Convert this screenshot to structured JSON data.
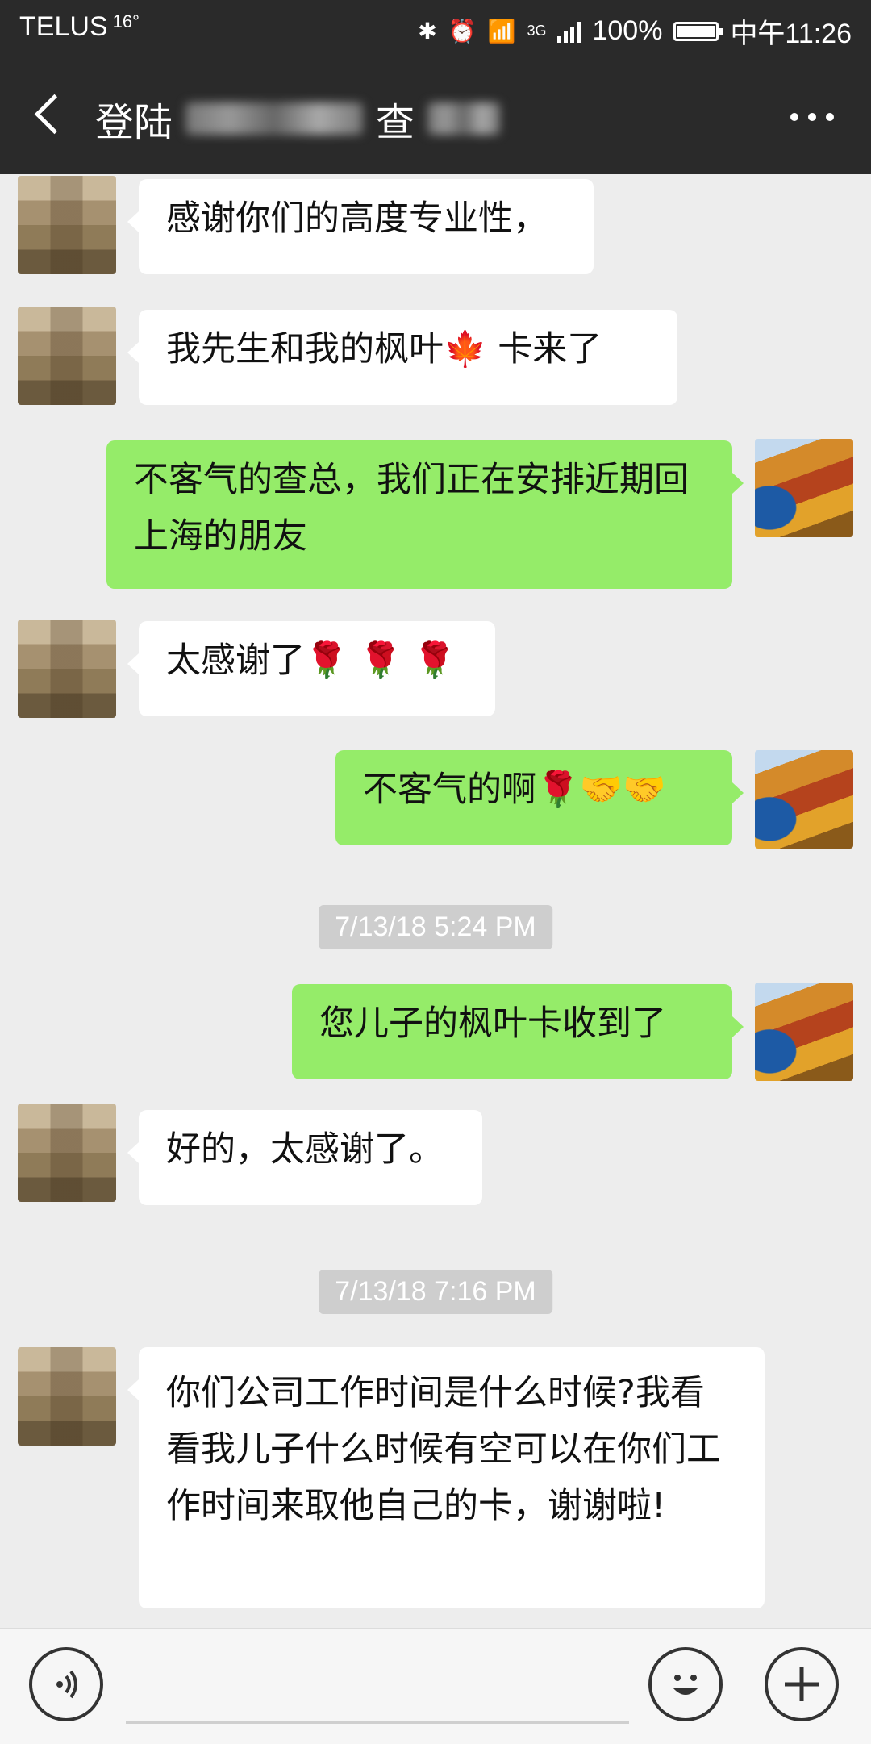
{
  "status_bar": {
    "carrier": "TELUS",
    "temperature": "16°",
    "network": "3G",
    "battery": "100%",
    "time": "中午11:26"
  },
  "header": {
    "title_prefix": "登陆",
    "title_middle": "查"
  },
  "messages": [
    {
      "side": "left",
      "text": "感谢你们的高度专业性，"
    },
    {
      "side": "left",
      "text": "我先生和我的枫叶🍁 卡来了"
    },
    {
      "side": "right",
      "text": "不客气的查总，我们正在安排近期回上海的朋友"
    },
    {
      "side": "left",
      "text": "太感谢了🌹 🌹 🌹"
    },
    {
      "side": "right",
      "text": "不客气的啊🌹🤝🤝"
    },
    {
      "type": "timestamp",
      "text": "7/13/18 5:24 PM"
    },
    {
      "side": "right",
      "text": "您儿子的枫叶卡收到了"
    },
    {
      "side": "left",
      "text": "好的，太感谢了。"
    },
    {
      "type": "timestamp",
      "text": "7/13/18 7:16 PM"
    },
    {
      "side": "left",
      "text": "你们公司工作时间是什么时候?我看看我儿子什么时候有空可以在你们工作时间来取他自己的卡，谢谢啦!"
    }
  ],
  "icons": {
    "back": "chevron-left-icon",
    "more": "more-dots-icon",
    "voice": "voice-icon",
    "emoji": "emoji-icon",
    "plus": "plus-icon"
  },
  "colors": {
    "bar_bg": "#2a2a2a",
    "chat_bg": "#ededed",
    "my_bubble": "#95ec69",
    "their_bubble": "#ffffff",
    "timestamp_bg": "#cecece"
  }
}
